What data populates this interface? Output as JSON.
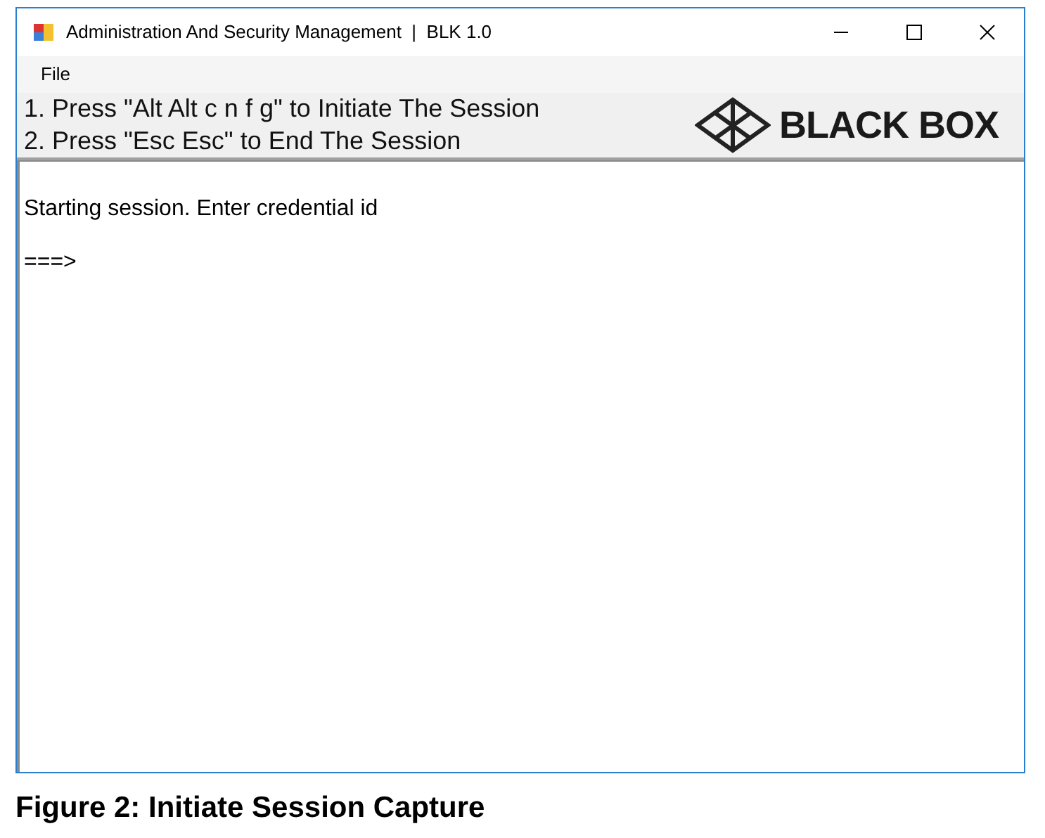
{
  "window": {
    "title": "Administration And Security Management  |  BLK 1.0"
  },
  "menu": [
    "File"
  ],
  "instructions": [
    "1. Press \"Alt Alt c n f g\" to Initiate The Session",
    "2. Press \"Esc Esc\" to End The Session"
  ],
  "logo": {
    "text": "BLACK BOX"
  },
  "console": {
    "lines": [
      "Starting session. Enter credential id",
      "===>"
    ]
  },
  "caption": "Figure 2: Initiate Session Capture"
}
